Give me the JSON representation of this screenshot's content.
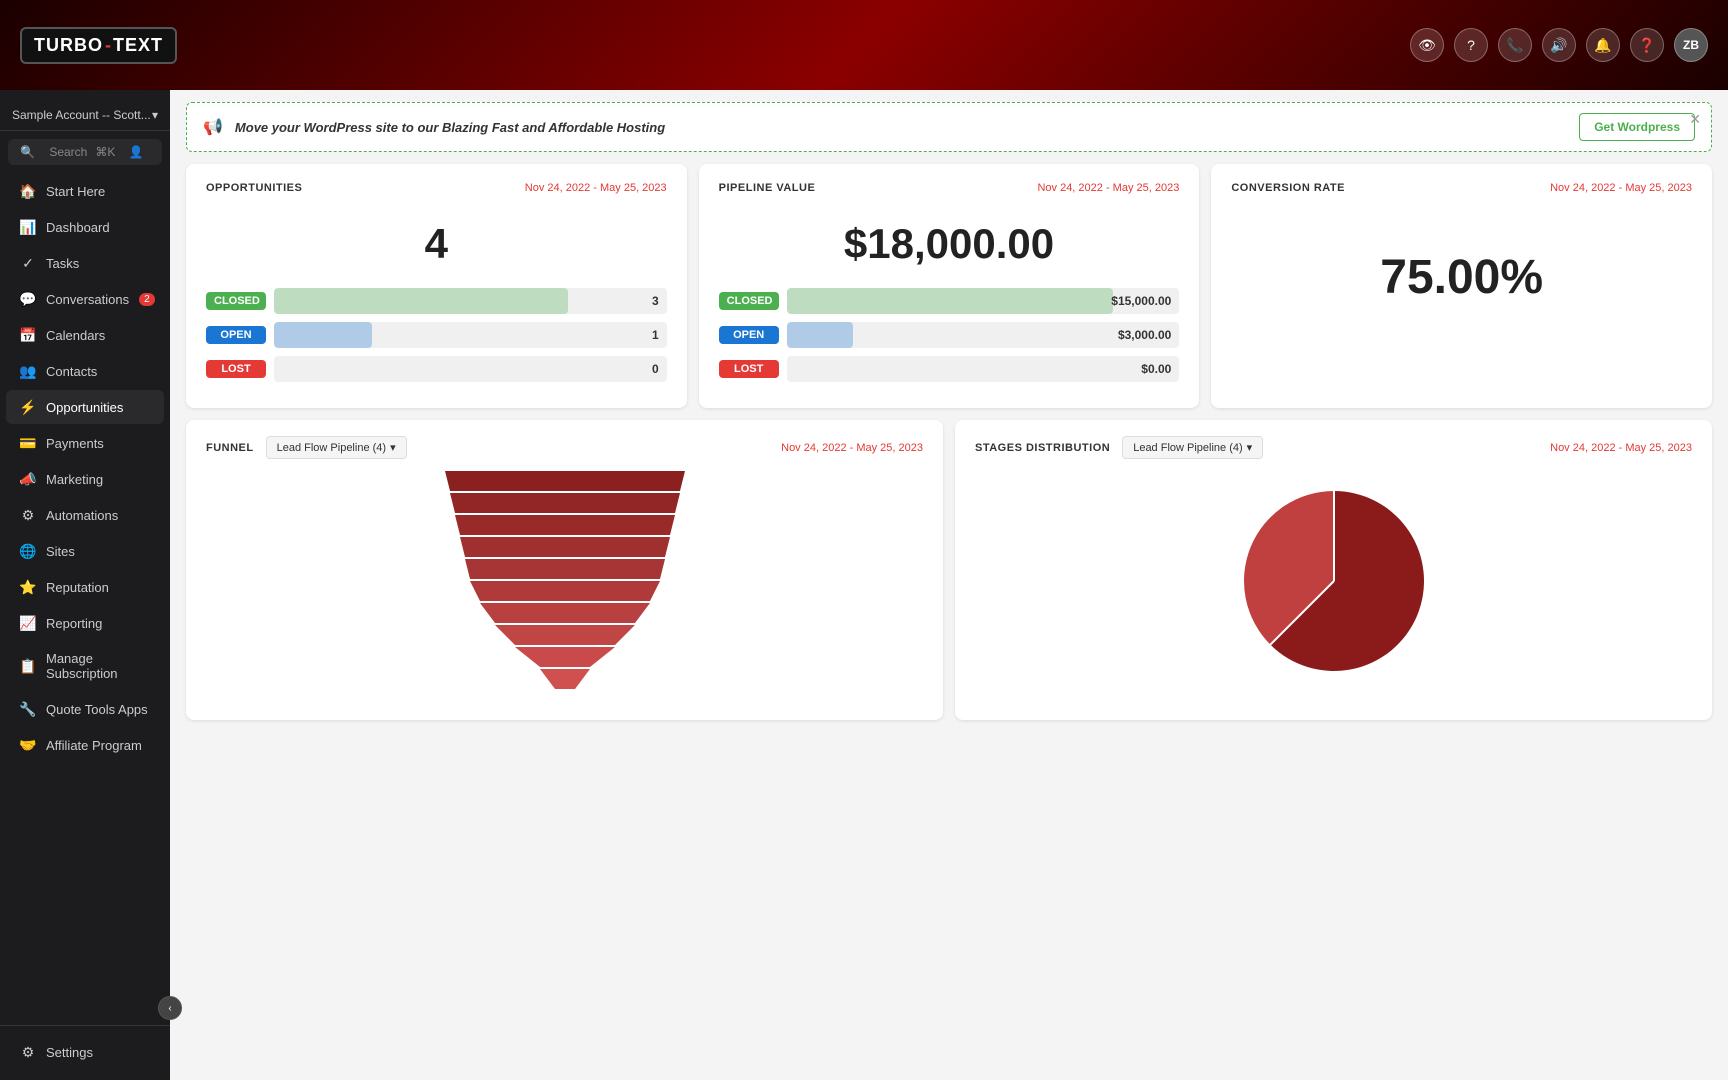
{
  "app": {
    "name": "TURBO-TEXT",
    "turbo": "TURBO",
    "dash": "-",
    "text": "TEXT"
  },
  "topbar": {
    "icons": [
      "👁",
      "?",
      "📞",
      "🔊",
      "🔔",
      "?"
    ],
    "avatar": "ZB"
  },
  "sidebar": {
    "account": "Sample Account -- Scott...",
    "search_placeholder": "Search",
    "search_shortcut": "⌘K",
    "items": [
      {
        "label": "Start Here",
        "icon": "🏠"
      },
      {
        "label": "Dashboard",
        "icon": "📊"
      },
      {
        "label": "Tasks",
        "icon": "✓"
      },
      {
        "label": "Conversations",
        "icon": "💬",
        "badge": "2"
      },
      {
        "label": "Calendars",
        "icon": "📅"
      },
      {
        "label": "Contacts",
        "icon": "👥"
      },
      {
        "label": "Opportunities",
        "icon": "⚡",
        "active": true
      },
      {
        "label": "Payments",
        "icon": "💳"
      },
      {
        "label": "Marketing",
        "icon": "📣"
      },
      {
        "label": "Automations",
        "icon": "⚙"
      },
      {
        "label": "Sites",
        "icon": "🌐"
      },
      {
        "label": "Reputation",
        "icon": "⭐"
      },
      {
        "label": "Reporting",
        "icon": "📈"
      },
      {
        "label": "Manage Subscription",
        "icon": "📋"
      },
      {
        "label": "Quote Tools Apps",
        "icon": "🔧"
      },
      {
        "label": "Affiliate Program",
        "icon": "🤝"
      }
    ],
    "settings": "Settings"
  },
  "banner": {
    "text": "Move your WordPress site to our Blazing Fast and Affordable Hosting",
    "btn": "Get Wordpress"
  },
  "opportunities": {
    "label": "OPPORTUNITIES",
    "date_range": "Nov 24, 2022 - May 25, 2023",
    "value": "4",
    "bars": [
      {
        "label": "CLOSED",
        "type": "closed",
        "count": 3,
        "pct": 75
      },
      {
        "label": "OPEN",
        "type": "open",
        "count": 1,
        "pct": 25
      },
      {
        "label": "LOST",
        "type": "lost",
        "count": 0,
        "pct": 0
      }
    ]
  },
  "pipeline": {
    "label": "PIPELINE VALUE",
    "date_range": "Nov 24, 2022 - May 25, 2023",
    "value": "$18,000.00",
    "bars": [
      {
        "label": "CLOSED",
        "type": "closed",
        "amount": "$15,000.00",
        "pct": 83
      },
      {
        "label": "OPEN",
        "type": "open",
        "amount": "$3,000.00",
        "pct": 17
      },
      {
        "label": "LOST",
        "type": "lost",
        "amount": "$0.00",
        "pct": 0
      }
    ]
  },
  "conversion": {
    "label": "CONVERSION RATE",
    "date_range": "Nov 24, 2022 - May 25, 2023",
    "value": "75.00%"
  },
  "funnel": {
    "label": "FUNNEL",
    "pipeline": "Lead Flow Pipeline (4)",
    "date_range": "Nov 24, 2022 - May 25, 2023"
  },
  "stages": {
    "label": "STAGES DISTRIBUTION",
    "pipeline": "Lead Flow Pipeline (4)",
    "date_range": "Nov 24, 2022 - May 25, 2023"
  }
}
